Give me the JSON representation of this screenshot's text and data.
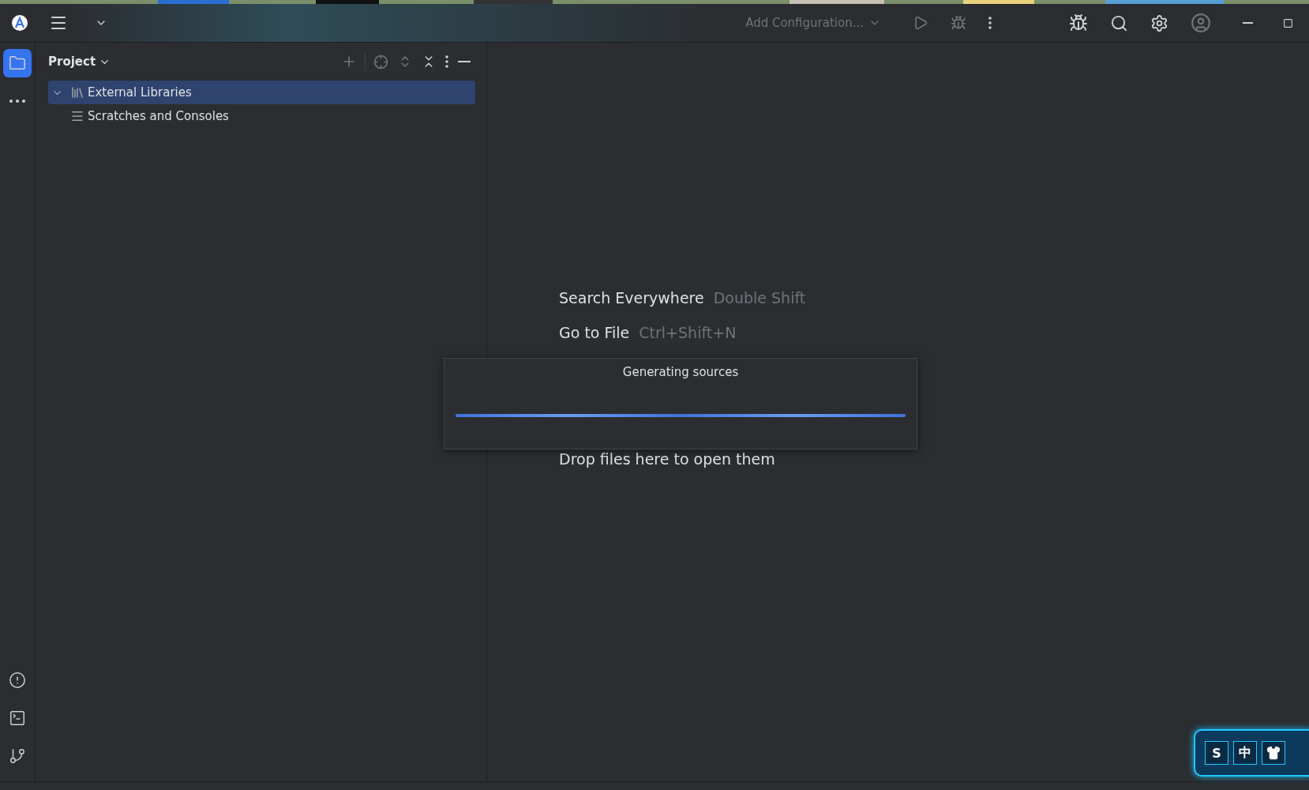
{
  "toolbar": {
    "run_config": {
      "label": "Add Configuration..."
    }
  },
  "sidebar": {
    "items": [
      {
        "kind": "folder",
        "selected": true
      },
      {
        "kind": "more",
        "selected": false
      }
    ],
    "bottom_items": [
      {
        "kind": "problems"
      },
      {
        "kind": "terminal"
      },
      {
        "kind": "git"
      }
    ]
  },
  "project_panel": {
    "title": "Project",
    "tree": [
      {
        "label": "External Libraries",
        "kind": "libraries",
        "expanded": true,
        "selected": true
      },
      {
        "label": "Scratches and Consoles",
        "kind": "scratches",
        "selected": false
      }
    ]
  },
  "editor_hints": [
    {
      "action": "Search Everywhere",
      "shortcut": "Double Shift"
    },
    {
      "action": "Go to File",
      "shortcut": "Ctrl+Shift+N"
    }
  ],
  "drop_hint": "Drop files here to open them",
  "progress_dialog": {
    "title": "Generating sources",
    "level": 1
  },
  "ime_toolbar": {
    "buttons": [
      "S",
      "中"
    ]
  }
}
